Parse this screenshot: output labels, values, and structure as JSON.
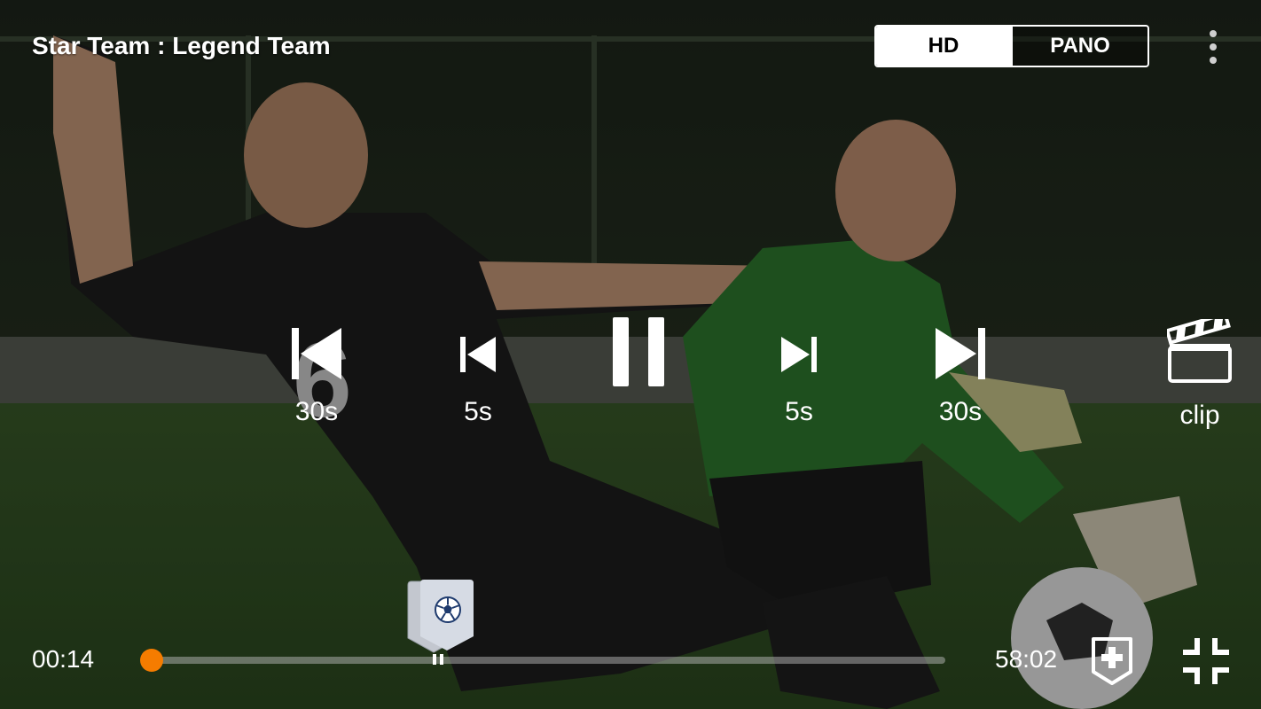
{
  "header": {
    "title": "Star Team : Legend Team",
    "quality_modes": [
      "HD",
      "PANO"
    ],
    "active_mode": "HD",
    "menu_icon": "more-vertical-icon"
  },
  "controls": {
    "rewind_30": {
      "label": "30s",
      "icon": "skip-back-30-icon"
    },
    "rewind_5": {
      "label": "5s",
      "icon": "skip-back-5-icon"
    },
    "play_pause": {
      "icon": "pause-icon"
    },
    "forward_5": {
      "label": "5s",
      "icon": "skip-forward-5-icon"
    },
    "forward_30": {
      "label": "30s",
      "icon": "skip-forward-30-icon"
    },
    "clip": {
      "label": "clip",
      "icon": "clapperboard-icon"
    }
  },
  "timeline": {
    "current_time": "00:14",
    "duration": "58:02",
    "progress_fraction": 0.004,
    "event_marker_icon": "soccer-ball-icon",
    "add_marker_icon": "add-tag-icon",
    "fullscreen_exit_icon": "exit-fullscreen-icon"
  },
  "colors": {
    "accent": "#f57c00",
    "active_toggle_bg": "#ffffff",
    "track": "#c8c8c8"
  }
}
